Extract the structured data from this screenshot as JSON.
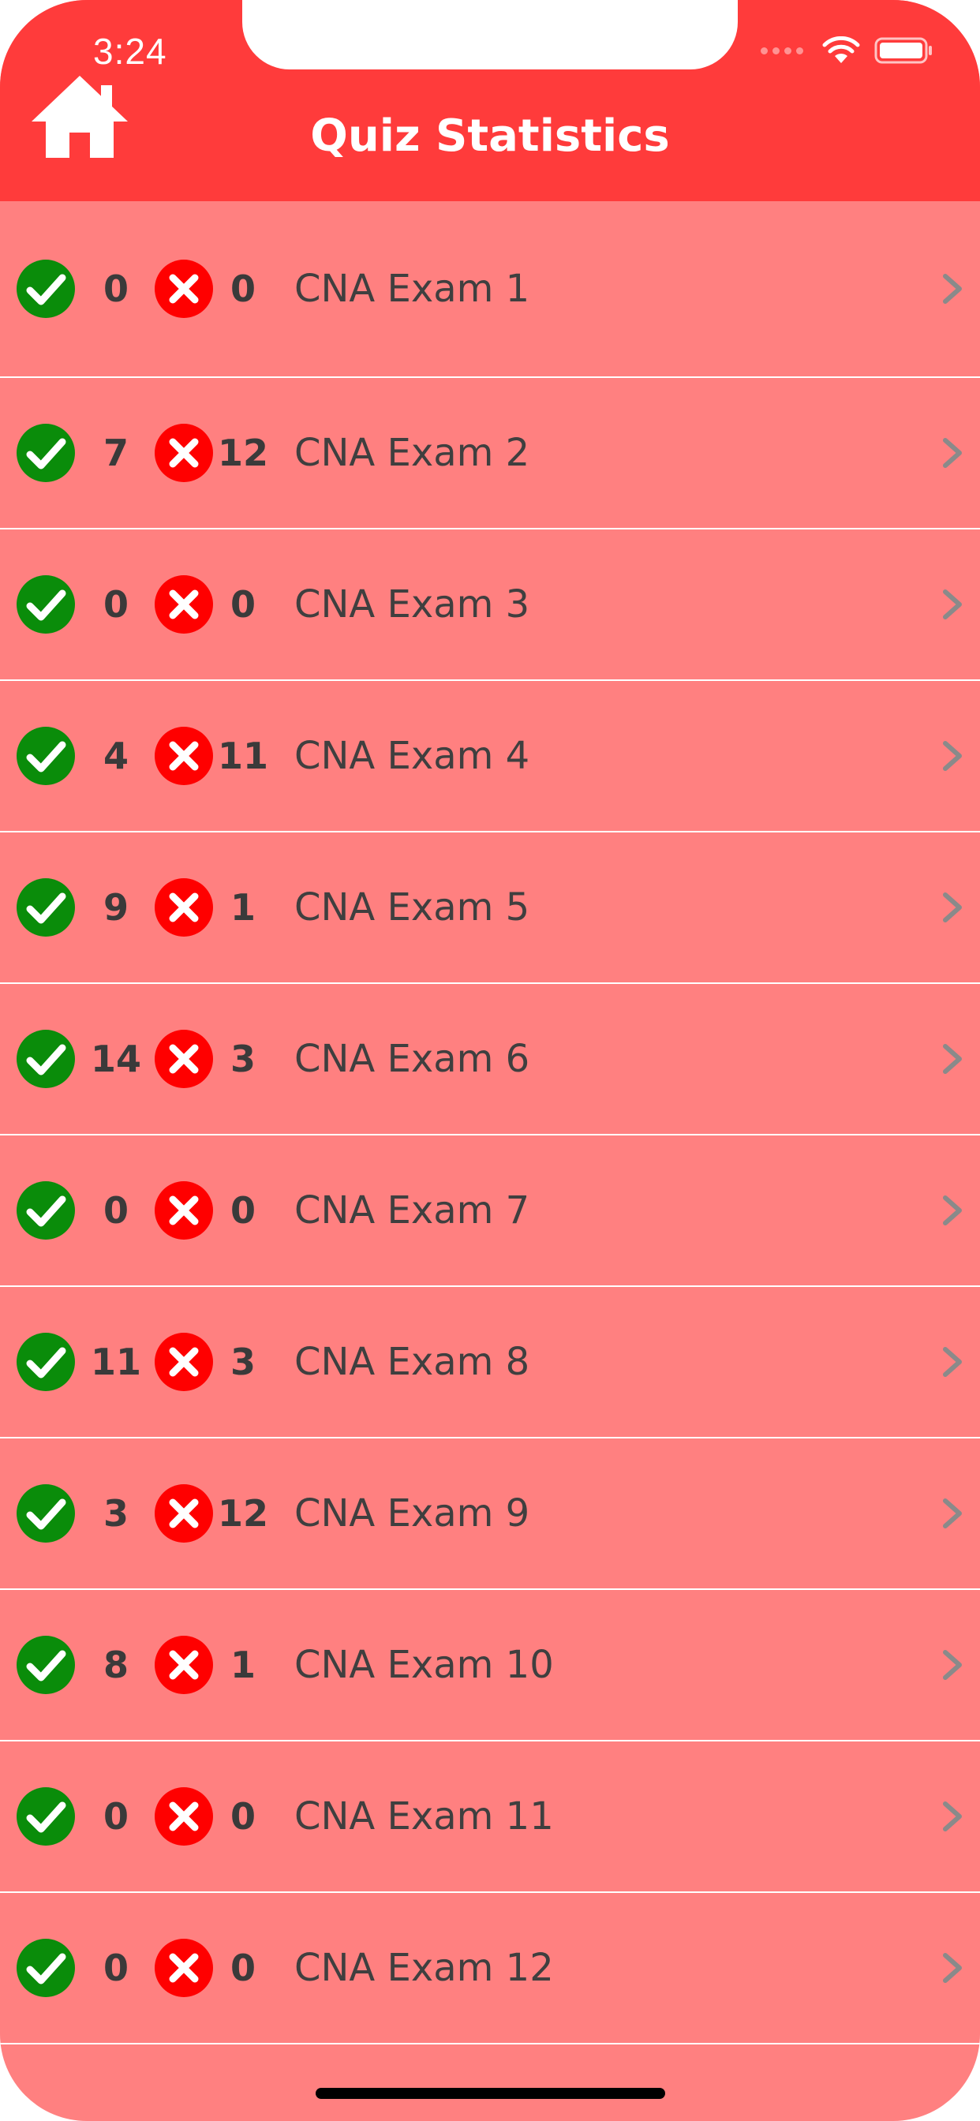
{
  "status_bar": {
    "time": "3:24"
  },
  "header": {
    "title": "Quiz Statistics",
    "home_icon": "house-icon",
    "background": "#ff3b3b"
  },
  "list": {
    "background": "#ff8080",
    "correct_icon": "check-circle-icon",
    "wrong_icon": "x-circle-icon",
    "correct_color": "#0a8c0a",
    "wrong_color": "#ff0000",
    "items": [
      {
        "correct": "0",
        "wrong": "0",
        "name": "CNA Exam 1"
      },
      {
        "correct": "7",
        "wrong": "12",
        "name": "CNA Exam 2"
      },
      {
        "correct": "0",
        "wrong": "0",
        "name": "CNA Exam 3"
      },
      {
        "correct": "4",
        "wrong": "11",
        "name": "CNA Exam 4"
      },
      {
        "correct": "9",
        "wrong": "1",
        "name": "CNA Exam 5"
      },
      {
        "correct": "14",
        "wrong": "3",
        "name": "CNA Exam 6"
      },
      {
        "correct": "0",
        "wrong": "0",
        "name": "CNA Exam 7"
      },
      {
        "correct": "11",
        "wrong": "3",
        "name": "CNA Exam 8"
      },
      {
        "correct": "3",
        "wrong": "12",
        "name": "CNA Exam 9"
      },
      {
        "correct": "8",
        "wrong": "1",
        "name": "CNA Exam 10"
      },
      {
        "correct": "0",
        "wrong": "0",
        "name": "CNA Exam 11"
      },
      {
        "correct": "0",
        "wrong": "0",
        "name": "CNA Exam 12"
      }
    ]
  }
}
